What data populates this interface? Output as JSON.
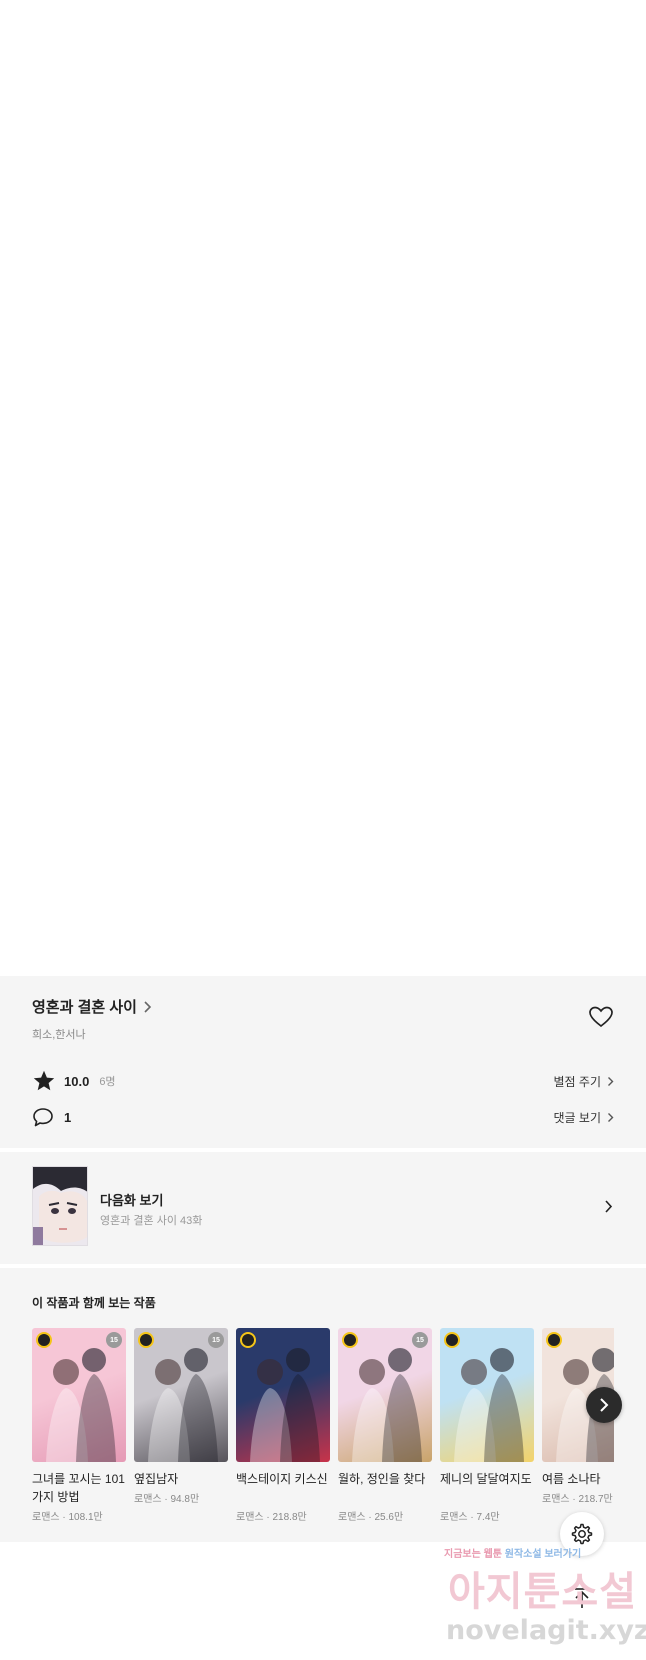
{
  "title_card": {
    "title": "영혼과 결혼 사이",
    "author": "희소,한서나",
    "rating": "10.0",
    "rating_count": "6명",
    "rate_link": "별점 주기",
    "comment_count": "1",
    "comment_link": "댓글 보기"
  },
  "next_episode": {
    "label": "다음화 보기",
    "subtitle": "영혼과 결혼 사이 43화"
  },
  "recommendations": {
    "heading": "이 작품과 함께 보는 작품",
    "items": [
      {
        "title": "그녀를 꼬시는 101가지 방법",
        "meta": "로맨스 · 108.1만",
        "age": "15",
        "colors": [
          "#f6c6d6",
          "#e59ab5"
        ]
      },
      {
        "title": "옆집남자",
        "meta": "로맨스 · 94.8만",
        "age": "15",
        "colors": [
          "#c9c6cc",
          "#56535a"
        ]
      },
      {
        "title": "백스테이지 키스신",
        "meta": "로맨스 · 218.8만",
        "age": "",
        "colors": [
          "#2a3a6a",
          "#c8334a"
        ]
      },
      {
        "title": "월하, 정인을 찾다",
        "meta": "로맨스 · 25.6만",
        "age": "15",
        "colors": [
          "#f1d6e6",
          "#c9a46a"
        ]
      },
      {
        "title": "제니의 달달여지도",
        "meta": "로맨스 · 7.4만",
        "age": "",
        "colors": [
          "#bfe1f3",
          "#f3d36a"
        ]
      },
      {
        "title": "여름 소나타",
        "meta": "로맨스 · 218.7만",
        "age": "",
        "colors": [
          "#f1e3dc",
          "#d8b7a8"
        ]
      }
    ]
  },
  "watermark": {
    "line1a": "지금보는 웹툰",
    "line1b": "원작소설 보러가기",
    "line2": "아지툰소설",
    "line3": "novelagit.xyz"
  }
}
